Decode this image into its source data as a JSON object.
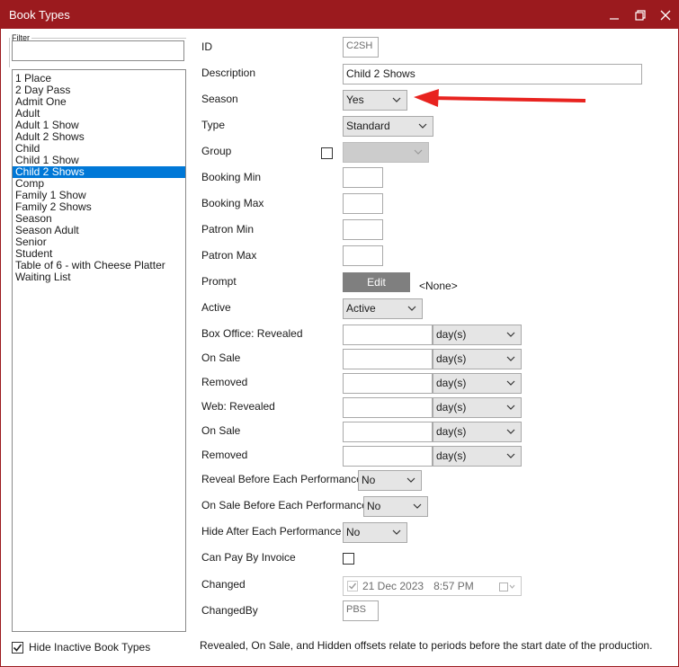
{
  "window": {
    "title": "Book Types",
    "accent": "#9b1a1e",
    "selection": "#0078d7"
  },
  "filter": {
    "legend": "Filter",
    "value": ""
  },
  "list": {
    "items": [
      "1 Place",
      "2 Day Pass",
      "Admit One",
      "Adult",
      "Adult 1 Show",
      "Adult 2 Shows",
      "Child",
      "Child 1 Show",
      "Child 2 Shows",
      "Comp",
      "Family 1 Show",
      "Family 2 Shows",
      "Season",
      "Season Adult",
      "Senior",
      "Student",
      "Table of 6 - with Cheese Platter",
      "Waiting List"
    ],
    "selected": "Child 2 Shows"
  },
  "hide_inactive": {
    "label": "Hide Inactive Book Types",
    "checked": true
  },
  "form": {
    "id": {
      "label": "ID",
      "value": "C2SH"
    },
    "description": {
      "label": "Description",
      "value": "Child 2 Shows"
    },
    "season": {
      "label": "Season",
      "value": "Yes"
    },
    "type": {
      "label": "Type",
      "value": "Standard"
    },
    "group": {
      "label": "Group",
      "value": ""
    },
    "booking_min": {
      "label": "Booking Min",
      "value": ""
    },
    "booking_max": {
      "label": "Booking Max",
      "value": ""
    },
    "patron_min": {
      "label": "Patron Min",
      "value": ""
    },
    "patron_max": {
      "label": "Patron Max",
      "value": ""
    },
    "prompt": {
      "label": "Prompt",
      "button": "Edit",
      "value": "<None>"
    },
    "active": {
      "label": "Active",
      "value": "Active"
    },
    "box_office_revealed": {
      "label": "Box Office: Revealed",
      "unit": "day(s)"
    },
    "box_office_on_sale": {
      "label": "On Sale",
      "unit": "day(s)"
    },
    "box_office_removed": {
      "label": "Removed",
      "unit": "day(s)"
    },
    "web_revealed": {
      "label": "Web: Revealed",
      "unit": "day(s)"
    },
    "web_on_sale": {
      "label": "On Sale",
      "unit": "day(s)"
    },
    "web_removed": {
      "label": "Removed",
      "unit": "day(s)"
    },
    "reveal_before": {
      "label": "Reveal Before Each Performance",
      "value": "No"
    },
    "on_sale_before": {
      "label": "On Sale Before Each Performance",
      "value": "No"
    },
    "hide_after": {
      "label": "Hide After Each Performance",
      "value": "No"
    },
    "can_pay_by_invoice": {
      "label": "Can Pay By Invoice",
      "checked": false
    },
    "changed": {
      "label": "Changed",
      "date": "21 Dec 2023",
      "time": "8:57 PM"
    },
    "changed_by": {
      "label": "ChangedBy",
      "value": "PBS"
    }
  },
  "footnote": "Revealed, On Sale, and Hidden offsets relate to periods before the start date of the production.",
  "annotation": {
    "arrow_color": "#e8231f"
  }
}
